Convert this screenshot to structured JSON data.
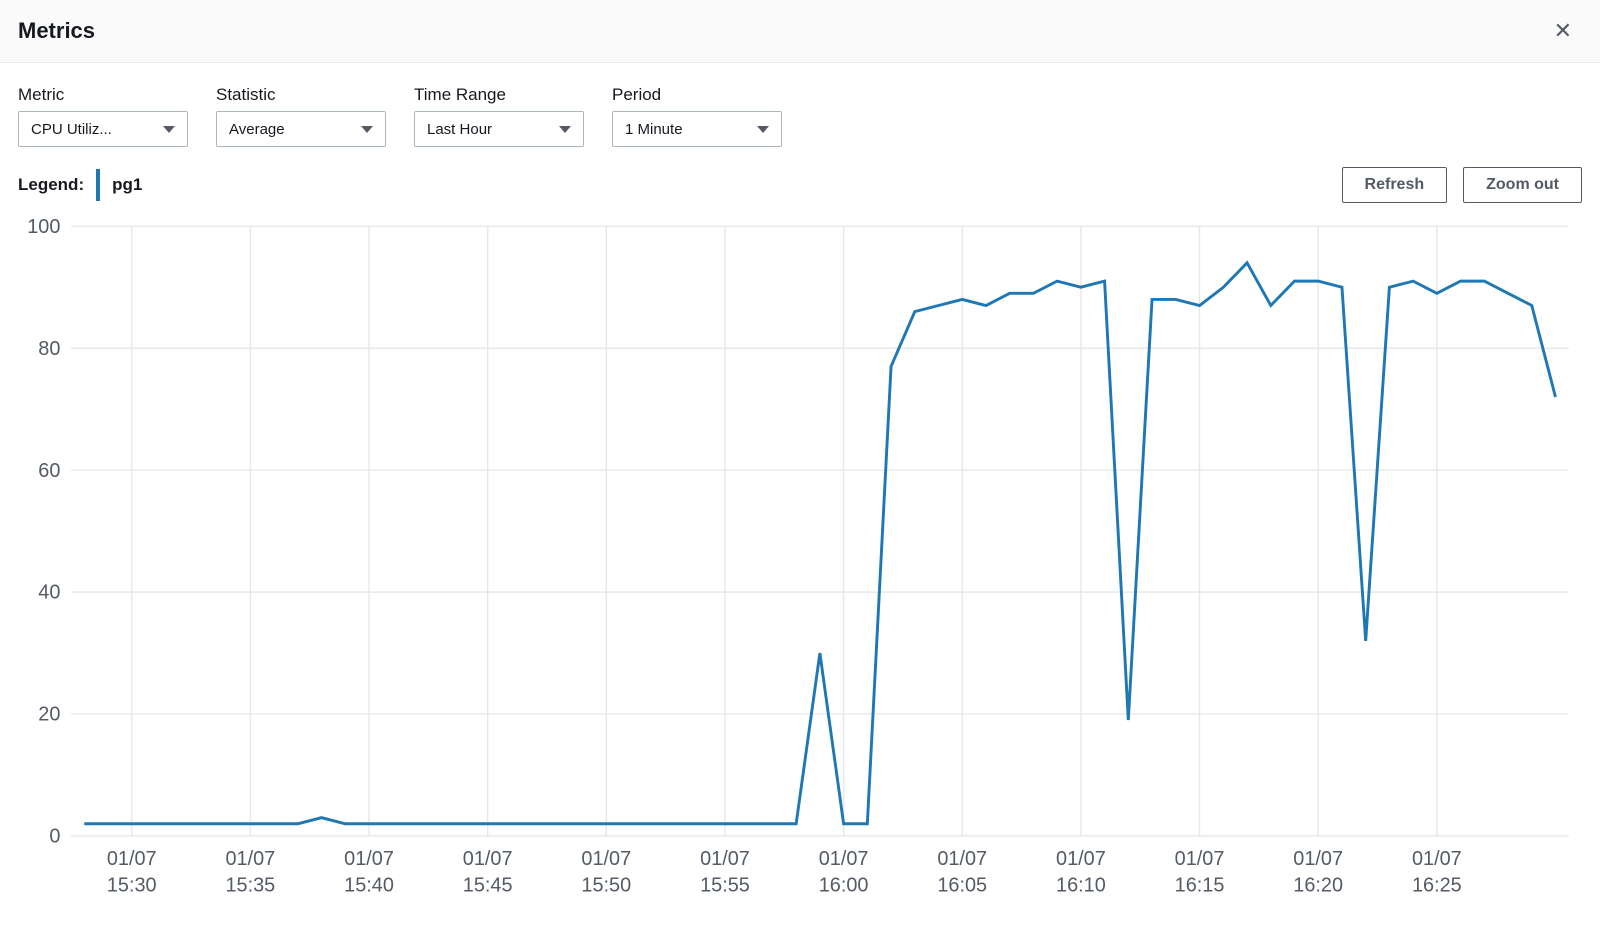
{
  "header": {
    "title": "Metrics",
    "close_icon": "close-icon"
  },
  "controls": {
    "metric": {
      "label": "Metric",
      "value": "CPU Utiliz..."
    },
    "statistic": {
      "label": "Statistic",
      "value": "Average"
    },
    "timerange": {
      "label": "Time Range",
      "value": "Last Hour"
    },
    "period": {
      "label": "Period",
      "value": "1 Minute"
    }
  },
  "legend": {
    "title": "Legend:",
    "series_name": "pg1",
    "series_color": "#1f77b4"
  },
  "buttons": {
    "refresh": "Refresh",
    "zoom_out": "Zoom out"
  },
  "chart_data": {
    "type": "line",
    "title": "",
    "xlabel": "",
    "ylabel": "",
    "ylim": [
      0,
      100
    ],
    "y_ticks": [
      0,
      20,
      40,
      60,
      80,
      100
    ],
    "x_tick_labels": [
      [
        "01/07",
        "15:30"
      ],
      [
        "01/07",
        "15:35"
      ],
      [
        "01/07",
        "15:40"
      ],
      [
        "01/07",
        "15:45"
      ],
      [
        "01/07",
        "15:50"
      ],
      [
        "01/07",
        "15:55"
      ],
      [
        "01/07",
        "16:00"
      ],
      [
        "01/07",
        "16:05"
      ],
      [
        "01/07",
        "16:10"
      ],
      [
        "01/07",
        "16:15"
      ],
      [
        "01/07",
        "16:20"
      ],
      [
        "01/07",
        "16:25"
      ]
    ],
    "series": [
      {
        "name": "pg1",
        "color": "#1f77b4",
        "values": [
          2,
          2,
          2,
          2,
          2,
          2,
          2,
          2,
          2,
          2,
          3,
          2,
          2,
          2,
          2,
          2,
          2,
          2,
          2,
          2,
          2,
          2,
          2,
          2,
          2,
          2,
          2,
          2,
          2,
          2,
          2,
          30,
          2,
          2,
          77,
          86,
          87,
          88,
          87,
          89,
          89,
          91,
          90,
          91,
          19,
          88,
          88,
          87,
          90,
          94,
          87,
          91,
          91,
          90,
          32,
          90,
          91,
          89,
          91,
          91,
          89,
          87,
          72
        ]
      }
    ]
  }
}
